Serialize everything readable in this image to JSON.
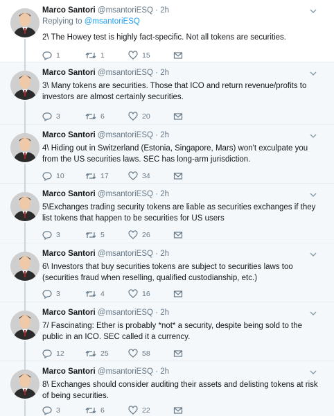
{
  "tweets": [
    {
      "name": "Marco Santori",
      "handle": "@msantoriESQ",
      "dot": "·",
      "time": "2h",
      "reply_prefix": "Replying to",
      "reply_mention": "@msantoriESQ",
      "text": "2\\ The Howey test is highly fact-specific. Not all tokens are securities.",
      "replies": "1",
      "retweets": "1",
      "likes": "15"
    },
    {
      "name": "Marco Santori",
      "handle": "@msantoriESQ",
      "dot": "·",
      "time": "2h",
      "text": "3\\ Many tokens are securities. Those that ICO and return revenue/profits to investors are almost certainly securities.",
      "replies": "3",
      "retweets": "6",
      "likes": "20"
    },
    {
      "name": "Marco Santori",
      "handle": "@msantoriESQ",
      "dot": "·",
      "time": "2h",
      "text": "4\\ Hiding out in Switzerland (Estonia, Singapore, Mars) won't exculpate you from the US securities laws. SEC has long-arm jurisdiction.",
      "replies": "10",
      "retweets": "17",
      "likes": "34"
    },
    {
      "name": "Marco Santori",
      "handle": "@msantoriESQ",
      "dot": "·",
      "time": "2h",
      "text": "5\\Exchanges trading security tokens are liable as securities exchanges if they list tokens that happen to be securities for US users",
      "replies": "3",
      "retweets": "5",
      "likes": "26"
    },
    {
      "name": "Marco Santori",
      "handle": "@msantoriESQ",
      "dot": "·",
      "time": "2h",
      "text": "6\\ Investors that buy securities tokens are subject to securities laws too (securities fraud when reselling, qualified custodianship, etc.)",
      "replies": "3",
      "retweets": "4",
      "likes": "16"
    },
    {
      "name": "Marco Santori",
      "handle": "@msantoriESQ",
      "dot": "·",
      "time": "2h",
      "text": "7/ Fascinating: Ether is probably *not* a security, despite being sold to the public in an ICO. SEC called it a currency.",
      "replies": "12",
      "retweets": "25",
      "likes": "58"
    },
    {
      "name": "Marco Santori",
      "handle": "@msantoriESQ",
      "dot": "·",
      "time": "2h",
      "text": "8\\ Exchanges should consider auditing their assets and delisting tokens at risk of being securities.",
      "replies": "3",
      "retweets": "6",
      "likes": "22"
    }
  ],
  "colors": {
    "accent": "#1da1f2",
    "secondary_text": "#657786",
    "thread_line": "#ccd6dd",
    "background": "#f5f8fa"
  },
  "icons": [
    "reply-icon",
    "retweet-icon",
    "like-icon",
    "message-icon",
    "chevron-down-icon"
  ]
}
